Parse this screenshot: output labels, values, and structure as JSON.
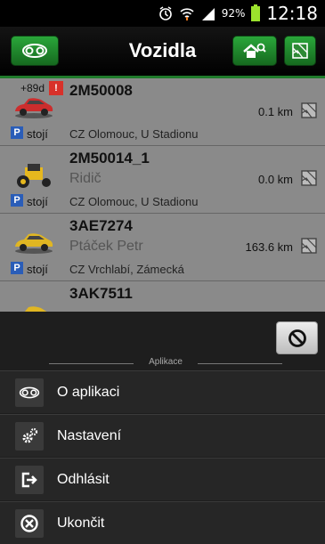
{
  "status_bar": {
    "battery_percent": "92%",
    "time": "12:18",
    "icons": [
      "alarm-icon",
      "wifi-icon",
      "signal-icon",
      "battery-icon"
    ]
  },
  "header": {
    "title": "Vozidla",
    "left_icon": "vehicles-logo-icon",
    "search_icon": "home-search-icon",
    "map_icon": "map-icon"
  },
  "vehicles": [
    {
      "plate": "2M50008",
      "driver": "",
      "distance": "0.1 km",
      "address": "CZ Olomouc, U Stadionu",
      "state": "stojí",
      "days_badge": "+89d",
      "warning": "!",
      "car_color": "#cc2d2d"
    },
    {
      "plate": "2M50014_1",
      "driver": "Ridič",
      "distance": "0.0 km",
      "address": "CZ Olomouc, U Stadionu",
      "state": "stojí",
      "days_badge": "",
      "warning": "",
      "car_color": "#e6b81e"
    },
    {
      "plate": "3AE7274",
      "driver": "Ptáček Petr",
      "distance": "163.6 km",
      "address": "CZ Vrchlabí, Zámecká",
      "state": "stojí",
      "days_badge": "",
      "warning": "",
      "car_color": "#e0b622"
    },
    {
      "plate": "3AK7511",
      "driver": "",
      "distance": "",
      "address": "",
      "state": "",
      "days_badge": "",
      "warning": "",
      "car_color": "#e0b622"
    }
  ],
  "menu": {
    "section_title": "Aplikace",
    "items": [
      {
        "label": "O aplikaci",
        "icon": "about-icon"
      },
      {
        "label": "Nastavení",
        "icon": "settings-icon"
      },
      {
        "label": "Odhlásit",
        "icon": "logout-icon"
      },
      {
        "label": "Ukončit",
        "icon": "exit-icon"
      }
    ],
    "cancel_icon": "cancel-icon"
  },
  "colors": {
    "accent_green": "#2aa63a",
    "status_blue": "#2a5db8",
    "warning_red": "#d8312a"
  }
}
